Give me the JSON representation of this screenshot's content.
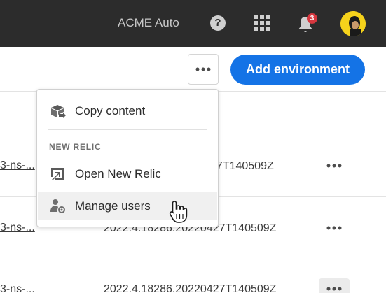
{
  "header": {
    "org_name": "ACME Auto",
    "help_icon": "help-icon",
    "apps_icon": "apps-grid-icon",
    "notifications_icon": "bell-icon",
    "notification_count": "3",
    "avatar_icon": "user-avatar"
  },
  "toolbar": {
    "more_actions_icon": "more-icon",
    "add_environment_label": "Add environment"
  },
  "menu": {
    "copy_content_label": "Copy content",
    "section_heading": "NEW RELIC",
    "open_new_relic_label": "Open New Relic",
    "manage_users_label": "Manage users"
  },
  "table": {
    "rows": [
      {
        "name": "3-ns-...",
        "version": "27T140509Z"
      },
      {
        "name": "3-ns-...",
        "version": "2022.4.18286.20220427T140509Z"
      },
      {
        "name": "3-ns-...",
        "version": "2022.4.18286.20220427T140509Z"
      }
    ]
  },
  "colors": {
    "topbar": "#2c2c2c",
    "accent": "#1473e6",
    "badge": "#d7373f",
    "avatar_bg": "#f5d21b"
  }
}
